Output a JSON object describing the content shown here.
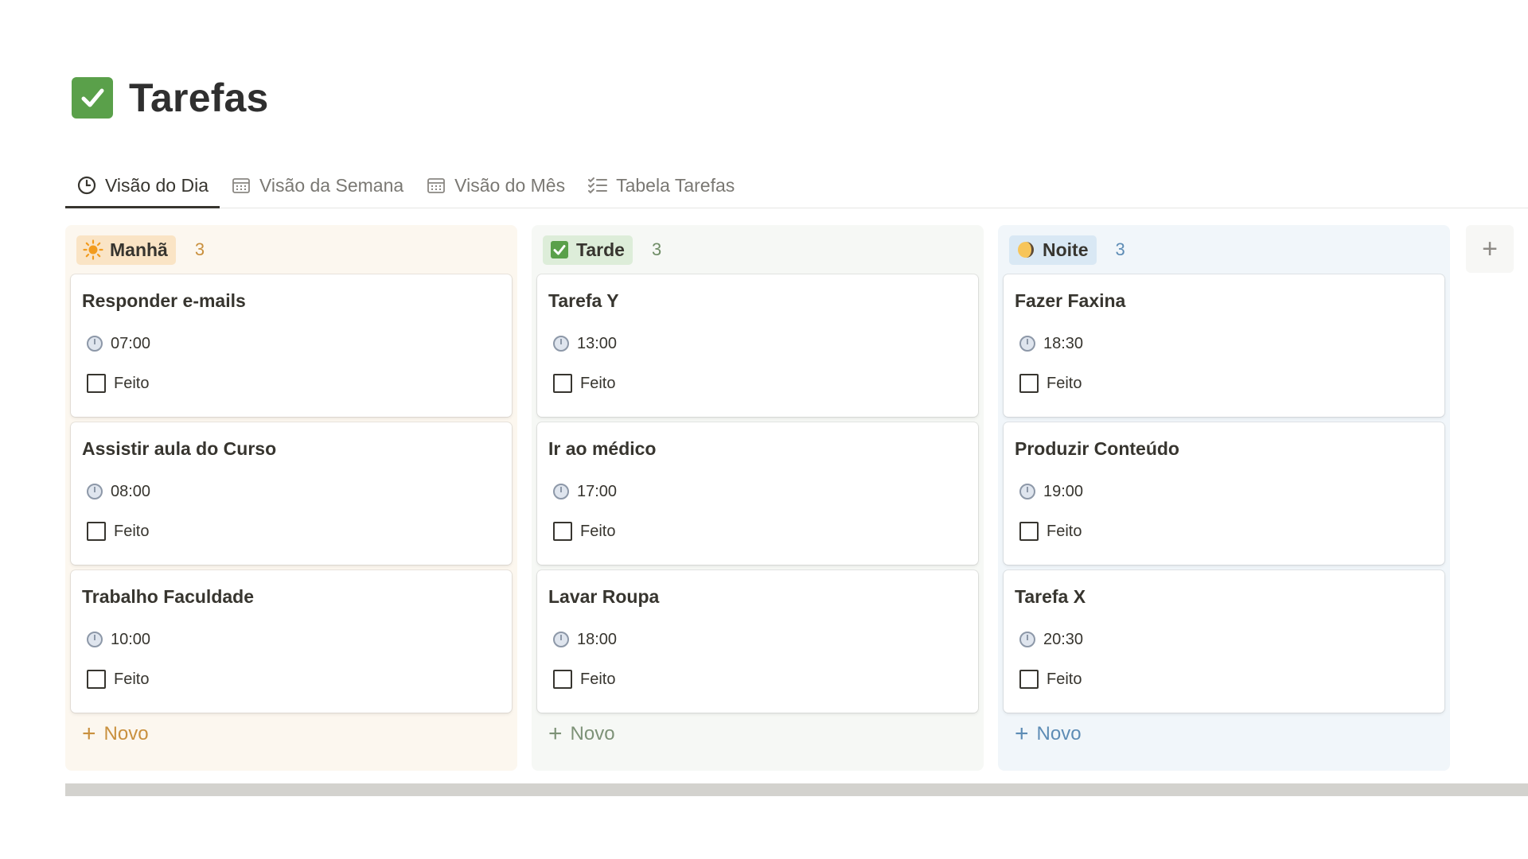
{
  "page": {
    "title": "Tarefas",
    "title_icon": "check-box-icon"
  },
  "tabs": [
    {
      "label": "Visão do Dia",
      "icon": "clock-icon",
      "active": true
    },
    {
      "label": "Visão da Semana",
      "icon": "calendar-icon",
      "active": false
    },
    {
      "label": "Visão do Mês",
      "icon": "calendar-icon",
      "active": false
    },
    {
      "label": "Tabela Tarefas",
      "icon": "checklist-icon",
      "active": false
    }
  ],
  "columns": [
    {
      "name": "Manhã",
      "icon": "sun-icon",
      "count": "3",
      "color": "#fae4c5",
      "cards": [
        {
          "title": "Responder e-mails",
          "time": "07:00",
          "done_label": "Feito"
        },
        {
          "title": "Assistir aula do Curso",
          "time": "08:00",
          "done_label": "Feito"
        },
        {
          "title": "Trabalho Faculdade",
          "time": "10:00",
          "done_label": "Feito"
        }
      ],
      "new_label": "Novo"
    },
    {
      "name": "Tarde",
      "icon": "check-box-icon",
      "count": "3",
      "color": "#ddedd9",
      "cards": [
        {
          "title": "Tarefa Y",
          "time": "13:00",
          "done_label": "Feito"
        },
        {
          "title": "Ir ao médico",
          "time": "17:00",
          "done_label": "Feito"
        },
        {
          "title": "Lavar Roupa",
          "time": "18:00",
          "done_label": "Feito"
        }
      ],
      "new_label": "Novo"
    },
    {
      "name": "Noite",
      "icon": "moon-icon",
      "count": "3",
      "color": "#d9e8f4",
      "cards": [
        {
          "title": "Fazer Faxina",
          "time": "18:30",
          "done_label": "Feito"
        },
        {
          "title": "Produzir Conteúdo",
          "time": "19:00",
          "done_label": "Feito"
        },
        {
          "title": "Tarefa X",
          "time": "20:30",
          "done_label": "Feito"
        }
      ],
      "new_label": "Novo"
    }
  ],
  "add_group_label": "+"
}
